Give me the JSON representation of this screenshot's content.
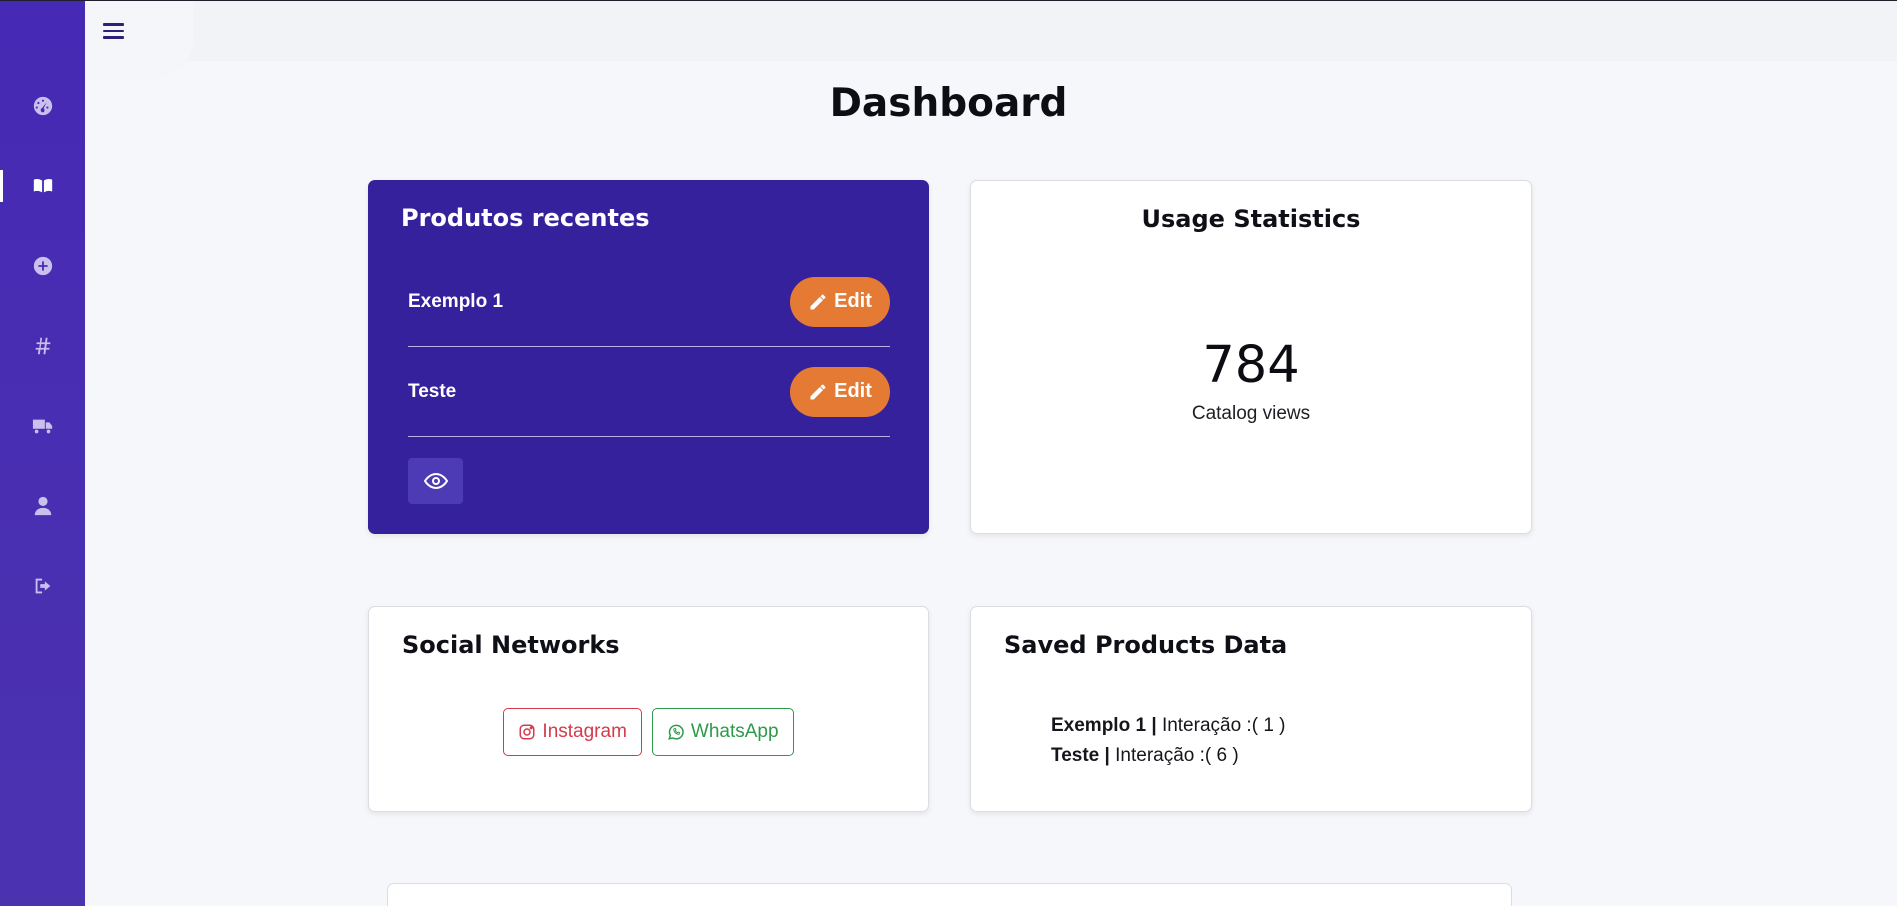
{
  "header": {
    "title": "Dashboard"
  },
  "sidebar": {
    "items": [
      {
        "icon": "dashboard-gauge-icon"
      },
      {
        "icon": "book-icon",
        "active": true
      },
      {
        "icon": "plus-circle-icon"
      },
      {
        "icon": "hashtag-icon"
      },
      {
        "icon": "truck-icon"
      },
      {
        "icon": "user-icon"
      },
      {
        "icon": "logout-icon"
      }
    ]
  },
  "recent_products": {
    "title": "Produtos recentes",
    "edit_label": "Edit",
    "items": [
      {
        "name": "Exemplo 1"
      },
      {
        "name": "Teste"
      }
    ]
  },
  "usage": {
    "title": "Usage Statistics",
    "value": "784",
    "caption": "Catalog views"
  },
  "social": {
    "title": "Social Networks",
    "instagram_label": "Instagram",
    "whatsapp_label": "WhatsApp"
  },
  "saved": {
    "title": "Saved Products Data",
    "separator": "|",
    "interaction_label": "Interação :",
    "items": [
      {
        "name": "Exemplo 1",
        "count": "( 1 )"
      },
      {
        "name": "Teste",
        "count": "( 6 )"
      }
    ]
  },
  "colors": {
    "sidebar": "#4629b4",
    "card_primary": "#35219c",
    "edit_button": "#e57a35",
    "instagram": "#d33b4b",
    "whatsapp": "#2d9a4a"
  }
}
